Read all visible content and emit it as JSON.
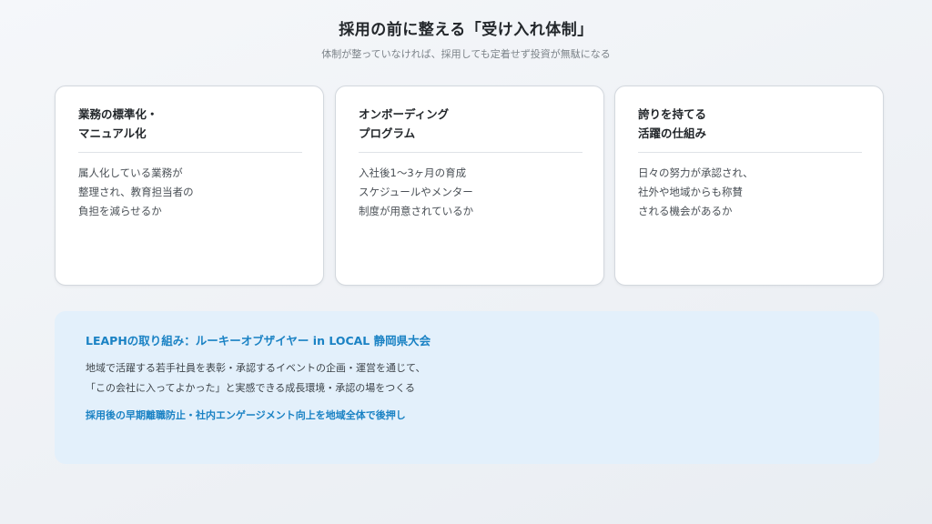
{
  "header": {
    "title": "採用の前に整える「受け入れ体制」",
    "subtitle": "体制が整っていなければ、採用しても定着せず投資が無駄になる"
  },
  "cards": [
    {
      "heading": [
        "業務の標準化・",
        "マニュアル化"
      ],
      "body": [
        "属人化している業務が",
        "整理され、教育担当者の",
        "負担を減らせるか"
      ]
    },
    {
      "heading": [
        "オンボーディング",
        "プログラム"
      ],
      "body": [
        "入社後1〜3ヶ月の育成",
        "スケジュールやメンター",
        "制度が用意されているか"
      ]
    },
    {
      "heading": [
        "誇りを持てる",
        "活躍の仕組み"
      ],
      "body": [
        "日々の努力が承認され、",
        "社外や地域からも称賛",
        "される機会があるか"
      ]
    }
  ],
  "panel": {
    "title": "LEAPHの取り組み：ルーキーオブザイヤー in LOCAL 静岡県大会",
    "body": [
      "地域で活躍する若手社員を表彰・承認するイベントの企画・運営を通じて、",
      "「この会社に入ってよかった」と実感できる成長環境・承認の場をつくる"
    ],
    "emphasis": "採用後の早期離職防止・社内エンゲージメント向上を地域全体で後押し"
  },
  "colors": {
    "accent": "#1a82c4",
    "panel_background": "#e3f0fb",
    "card_border": "#d3d8de"
  }
}
